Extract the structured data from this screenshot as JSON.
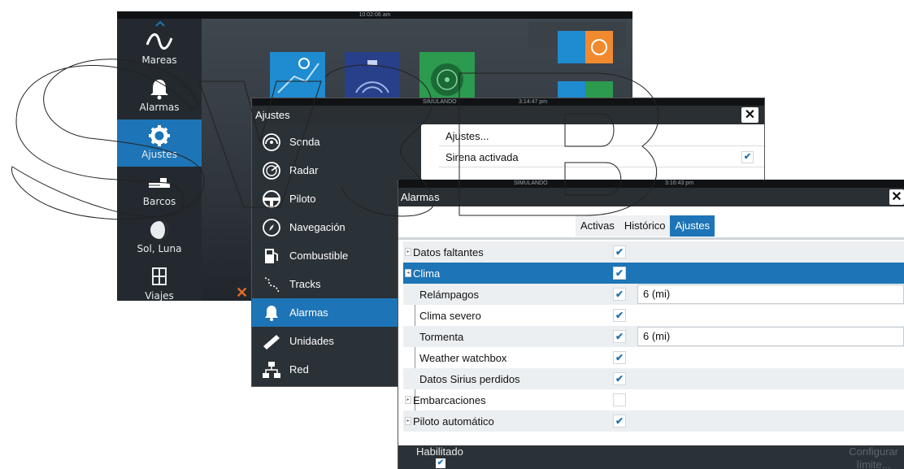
{
  "colors": {
    "accent": "#1d74b6",
    "dark_panel": "#2a3137",
    "title_bar": "#2a2f33",
    "check": "#1d74b6"
  },
  "home": {
    "status_time": "10:02:06 am",
    "close_label": "Cerrar",
    "sidebar": [
      {
        "label": "Mareas",
        "icon": "wave-icon"
      },
      {
        "label": "Alarmas",
        "icon": "bell-icon"
      },
      {
        "label": "Ajustes",
        "icon": "gear-icon",
        "active": true
      },
      {
        "label": "Barcos",
        "icon": "ship-icon"
      },
      {
        "label": "Sol, Luna",
        "icon": "moon-icon"
      },
      {
        "label": "Viajes",
        "icon": "calculator-icon"
      }
    ]
  },
  "settings": {
    "status_text": "SIMULANDO",
    "status_time": "3:14:47 pm",
    "title": "Ajustes",
    "close_symbol": "✕",
    "menu": [
      {
        "label": "Sonda",
        "icon": "sonar-icon"
      },
      {
        "label": "Radar",
        "icon": "radar-icon"
      },
      {
        "label": "Piloto",
        "icon": "steering-wheel-icon"
      },
      {
        "label": "Navegación",
        "icon": "compass-icon"
      },
      {
        "label": "Combustible",
        "icon": "fuel-pump-icon"
      },
      {
        "label": "Tracks",
        "icon": "tracks-icon"
      },
      {
        "label": "Alarmas",
        "icon": "bell-icon",
        "active": true
      },
      {
        "label": "Unidades",
        "icon": "ruler-icon"
      },
      {
        "label": "Red",
        "icon": "network-icon"
      }
    ],
    "rows": [
      {
        "label": "Ajustes..."
      },
      {
        "label": "Sirena activada",
        "checked": true
      }
    ]
  },
  "alarms": {
    "status_text": "SIMULANDO",
    "status_time": "3:16:43 pm",
    "title": "Alarmas",
    "close_symbol": "✕",
    "tabs": [
      {
        "label": "Activas"
      },
      {
        "label": "Histórico"
      },
      {
        "label": "Ajustes",
        "active": true
      }
    ],
    "rows": [
      {
        "label": "Datos faltantes",
        "checked": true,
        "expander": "▸",
        "level": 0
      },
      {
        "label": "Clima",
        "checked": true,
        "expander": "◂",
        "level": 0,
        "selected": true
      },
      {
        "label": "Relámpagos",
        "checked": true,
        "level": 1,
        "value": "6 (mi)"
      },
      {
        "label": "Clima severo",
        "checked": true,
        "level": 1
      },
      {
        "label": "Tormenta",
        "checked": true,
        "level": 1,
        "value": "6 (mi)"
      },
      {
        "label": "Weather watchbox",
        "checked": true,
        "level": 1
      },
      {
        "label": "Datos Sirius perdidos",
        "checked": true,
        "level": 1
      },
      {
        "label": "Embarcaciones",
        "checked": false,
        "expander": "▸",
        "level": 0
      },
      {
        "label": "Piloto automático",
        "checked": true,
        "expander": "▸",
        "level": 0
      }
    ],
    "bottom": {
      "enabled_label": "Habilitado",
      "enabled_checked": true,
      "configure_label_line1": "Configurar",
      "configure_label_line2": "límite..."
    },
    "check_glyph": "✔"
  }
}
